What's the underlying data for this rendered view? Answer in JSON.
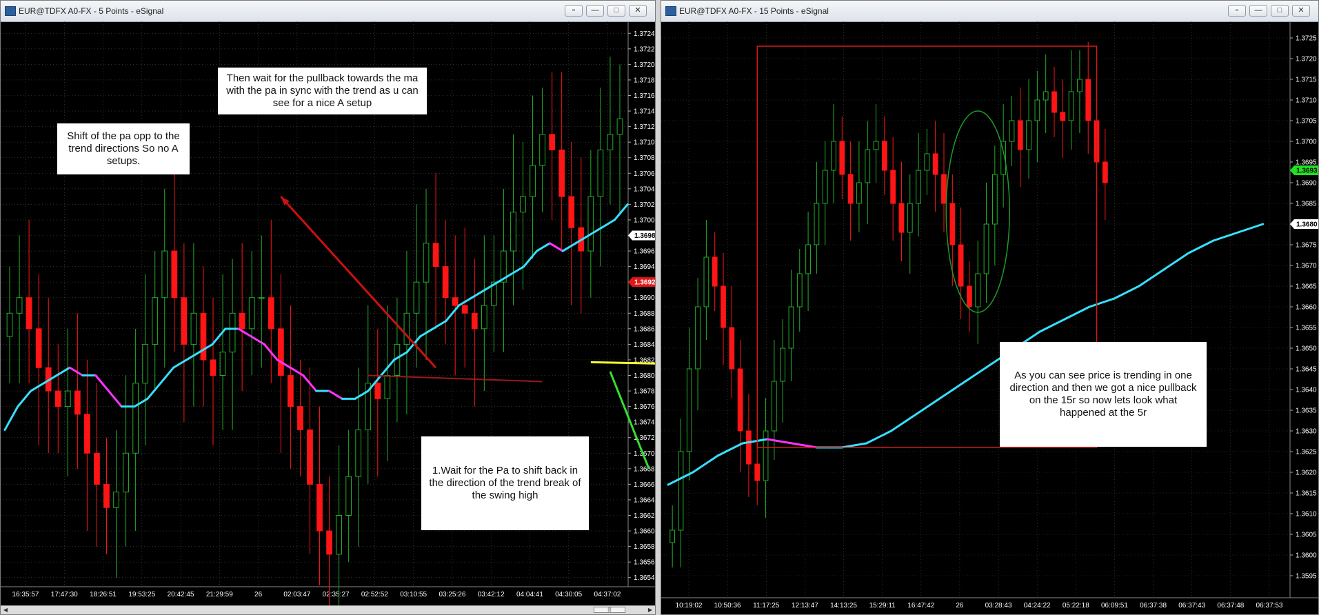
{
  "colors": {
    "bull": "#22b02a",
    "bear": "#ff1515",
    "ma_up": "#36e0ff",
    "ma_down": "#ff33ff",
    "annotation_arrow": "#cc1111",
    "support_line": "#ffff33",
    "axis_text": "#ffffff",
    "grid": "#4a4a4a"
  },
  "windows": [
    {
      "title": "EUR@TDFX A0-FX - 5 Points - eSignal",
      "annotations": [
        {
          "text": "Shift of the pa opp to the trend directions So no A setups."
        },
        {
          "text": "Then wait for the pullback towards the ma with the pa in sync with the trend as u can see for a nice A setup"
        },
        {
          "text": "1.Wait for the Pa to shift back in the direction of the trend break of the swing high"
        }
      ],
      "chart_data": {
        "type": "candlestick",
        "ylim": [
          1.3653,
          1.3725
        ],
        "yticks": [
          "1.3724",
          "1.3722",
          "1.3720",
          "1.3718",
          "1.3716",
          "1.3714",
          "1.3712",
          "1.3710",
          "1.3708",
          "1.3706",
          "1.3704",
          "1.3702",
          "1.3700",
          "1.3698",
          "1.3696",
          "1.3694",
          "1.3692",
          "1.3690",
          "1.3688",
          "1.3686",
          "1.3684",
          "1.3682",
          "1.3680",
          "1.3678",
          "1.3676",
          "1.3674",
          "1.3672",
          "1.3670",
          "1.3668",
          "1.3666",
          "1.3664",
          "1.3662",
          "1.3660",
          "1.3658",
          "1.3656",
          "1.3654"
        ],
        "xticks": [
          "16:35:57",
          "17:47:30",
          "18:26:51",
          "19:53:25",
          "20:42:45",
          "21:29:59",
          "26",
          "02:03:47",
          "02:35:27",
          "02:52:52",
          "03:10:55",
          "03:25:26",
          "03:42:12",
          "04:04:41",
          "04:30:05",
          "04:37:02"
        ],
        "last_price": "1.3698",
        "marker_price": "1.3692",
        "close": [
          1.3688,
          1.369,
          1.3686,
          1.3681,
          1.3678,
          1.3676,
          1.3678,
          1.3675,
          1.367,
          1.3666,
          1.3663,
          1.3665,
          1.367,
          1.3679,
          1.3684,
          1.369,
          1.3696,
          1.369,
          1.3684,
          1.3688,
          1.3682,
          1.368,
          1.3683,
          1.3688,
          1.3686,
          1.369,
          1.369,
          1.3686,
          1.368,
          1.3676,
          1.3673,
          1.3666,
          1.366,
          1.3657,
          1.3662,
          1.3667,
          1.3673,
          1.3679,
          1.3677,
          1.368,
          1.3684,
          1.3688,
          1.3692,
          1.3697,
          1.3694,
          1.369,
          1.3689,
          1.3688,
          1.3686,
          1.3689,
          1.3692,
          1.3696,
          1.3701,
          1.3703,
          1.3707,
          1.3711,
          1.3709,
          1.3703,
          1.3699,
          1.3696,
          1.3703,
          1.3709,
          1.3711,
          1.3713
        ],
        "ma": [
          1.3673,
          1.3676,
          1.3678,
          1.3679,
          1.368,
          1.3681,
          1.368,
          1.368,
          1.3678,
          1.3676,
          1.3676,
          1.3677,
          1.3679,
          1.3681,
          1.3682,
          1.3683,
          1.3684,
          1.3686,
          1.3686,
          1.3685,
          1.3684,
          1.3682,
          1.3681,
          1.368,
          1.3678,
          1.3678,
          1.3677,
          1.3677,
          1.3678,
          1.368,
          1.3682,
          1.3683,
          1.3685,
          1.3686,
          1.3687,
          1.3689,
          1.369,
          1.3691,
          1.3692,
          1.3693,
          1.3694,
          1.3696,
          1.3697,
          1.3696,
          1.3697,
          1.3698,
          1.3699,
          1.37,
          1.3702
        ]
      }
    },
    {
      "title": "EUR@TDFX A0-FX - 15 Points - eSignal",
      "annotations": [
        {
          "text": "As you can see price is trending in one direction and then we got a  nice pullback on the 15r so now lets look what happened at the 5r"
        }
      ],
      "chart_data": {
        "type": "candlestick",
        "ylim": [
          1.3591,
          1.3728
        ],
        "yticks": [
          "1.3725",
          "1.3720",
          "1.3715",
          "1.3710",
          "1.3705",
          "1.3700",
          "1.3695",
          "1.3690",
          "1.3685",
          "1.3680",
          "1.3675",
          "1.3670",
          "1.3665",
          "1.3660",
          "1.3655",
          "1.3650",
          "1.3645",
          "1.3640",
          "1.3635",
          "1.3630",
          "1.3625",
          "1.3620",
          "1.3615",
          "1.3610",
          "1.3605",
          "1.3600",
          "1.3595"
        ],
        "xticks": [
          "10:19:02",
          "10:50:36",
          "11:17:25",
          "12:13:47",
          "14:13:25",
          "15:29:11",
          "16:47:42",
          "26",
          "03:28:43",
          "04:24:22",
          "05:22:18",
          "06:09:51",
          "06:37:38",
          "06:37:43",
          "06:37:48",
          "06:37:53"
        ],
        "last_price": "1.3693",
        "marker_price": "1.3680",
        "close": [
          1.3606,
          1.3625,
          1.3645,
          1.366,
          1.3672,
          1.3665,
          1.3655,
          1.3645,
          1.363,
          1.3622,
          1.3618,
          1.363,
          1.3642,
          1.365,
          1.366,
          1.3668,
          1.3675,
          1.3685,
          1.3693,
          1.37,
          1.3692,
          1.3685,
          1.369,
          1.3698,
          1.37,
          1.3693,
          1.3685,
          1.3678,
          1.3685,
          1.3693,
          1.3697,
          1.3692,
          1.3685,
          1.3675,
          1.3665,
          1.366,
          1.3668,
          1.368,
          1.3692,
          1.37,
          1.3705,
          1.3698,
          1.3705,
          1.371,
          1.3712,
          1.3707,
          1.3705,
          1.3712,
          1.3715,
          1.3705,
          1.3695,
          1.369
        ],
        "ma": [
          1.3617,
          1.362,
          1.3624,
          1.3627,
          1.3628,
          1.3627,
          1.3626,
          1.3626,
          1.3627,
          1.363,
          1.3634,
          1.3638,
          1.3642,
          1.3646,
          1.365,
          1.3654,
          1.3657,
          1.366,
          1.3662,
          1.3665,
          1.3669,
          1.3673,
          1.3676,
          1.3678,
          1.368
        ]
      }
    }
  ]
}
